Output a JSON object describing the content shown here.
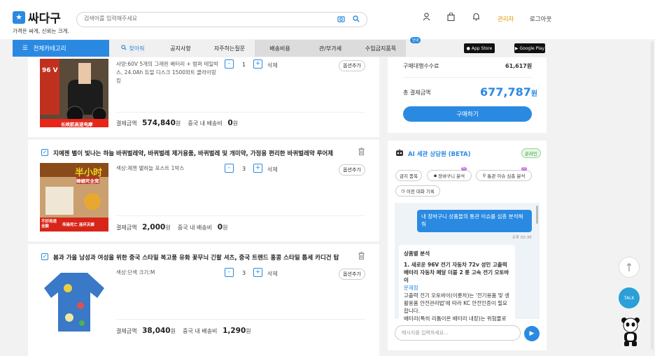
{
  "header": {
    "logo_text": "싸다구",
    "logo_tagline": "가격은 싸게, 신뢰는 크게.",
    "search_placeholder": "검색어를 입력해주세요",
    "admin_link": "관리자",
    "logout_link": "로그아웃",
    "accent_color": "#2a8ae2"
  },
  "nav": {
    "category_label": "전체카테고리",
    "tabs": [
      "찾아줘",
      "공지사항",
      "자주하는질문",
      "배송비용",
      "관/부가세",
      "수입금지품목"
    ],
    "new_badge": "안내",
    "app_store": "App Store",
    "google_play": "Google Play"
  },
  "products": [
    {
      "title": "",
      "option": "사양:60V 5개의 그래핀 배터리 + 범퍼 테일박스, 24.0Ah 듀얼 디스크 1500와트 클라이밍 킹",
      "qty": "1",
      "delete_label": "삭제",
      "option_add_label": "옵션추가",
      "pay_label": "결제금액",
      "pay_value": "574,840",
      "pay_unit": "원",
      "ship_label": "중국 내 배송비",
      "ship_value": "0",
      "ship_unit": "원",
      "thumb_texts": [
        "96 V",
        "长续航高速电摩"
      ]
    },
    {
      "title": "지예젠 별이 빛나는 하늘 바퀴벌레약, 바퀴벌레 제거용품, 바퀴벌레 및 개미약, 가정용 편리한 바퀴벌레약 루어제",
      "option": "색상:제젠 별하늘 포스트 1박스",
      "qty": "3",
      "delete_label": "삭제",
      "option_add_label": "옵션추가",
      "pay_label": "결제금액",
      "pay_value": "2,000",
      "pay_unit": "원",
      "ship_label": "중국 내 배송비",
      "ship_value": "0",
      "ship_unit": "원",
      "thumb_texts": [
        "半小时",
        "蟑螂死全窝",
        "不好用退全款",
        "传染死亡 连环灭蟑"
      ]
    },
    {
      "title": "봄과 가을 남성과 여성을 위한 중국 스타일 복고풍 유화 꽃무늬 긴팔 셔츠, 중국 트렌드 홍콩 스타일 톱세 카디건 탑",
      "option": "색상:단색 크기:M",
      "qty": "3",
      "delete_label": "삭제",
      "option_add_label": "옵션추가",
      "pay_label": "결제금액",
      "pay_value": "38,040",
      "pay_unit": "원",
      "ship_label": "중국 내 배송비",
      "ship_value": "1,290",
      "ship_unit": "원",
      "thumb_texts": []
    }
  ],
  "summary": {
    "fee_label": "구매대행수수료",
    "fee_value": "61,617원",
    "total_label": "총 결제금액",
    "total_value": "677,787",
    "total_unit": "원",
    "order_button": "구매하기"
  },
  "ai": {
    "title": "AI 세관 상담원 (BETA)",
    "status": "온라인",
    "chips": [
      "금지 품목",
      "장바구니 분석",
      "통관 이슈 심층 분석",
      "이전 대화 기록"
    ],
    "chip_badge": "AI",
    "user_message": "내 장바구니 상품들의 통관 이슈를 심층 분석해 줘",
    "time": "오후 02:35",
    "bot_heading": "상품별 분석",
    "bot_item": "1. 새로운 96V 전기 자동차 72v 성인 고출력 배터리 자동차 페달 더블 2 륜 고속 전기 오토바이",
    "bot_subhead": "문제점",
    "bot_text1": "고출력 전기 오토바이(이륜차)는 '전기용품 및 생활용품 안전관리법'에 따라 KC 안전인증이 필요합니다.",
    "bot_text2": "배터리(특히 리튬이온 배터리 내장)는 위험물로",
    "input_placeholder": "메시지를 입력하세요...",
    "send_label": "▶"
  },
  "floating": {
    "top_label": "↑",
    "talk_label": "TALK"
  }
}
